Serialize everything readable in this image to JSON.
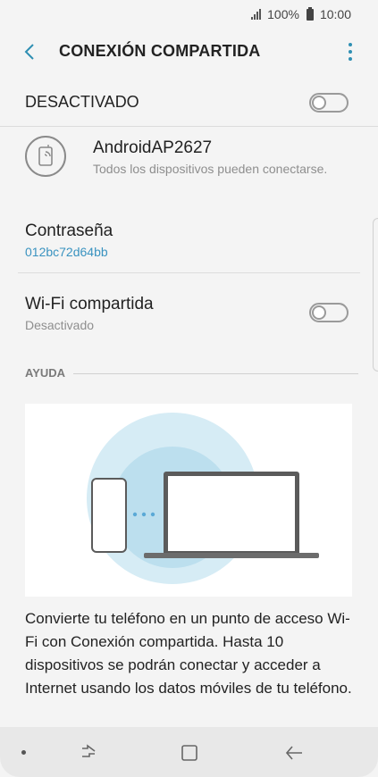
{
  "status_bar": {
    "signal_icon": "signal-icon",
    "battery_percent": "100%",
    "battery_icon": "battery-icon",
    "time": "10:00"
  },
  "header": {
    "title": "CONEXIÓN COMPARTIDA",
    "back_icon": "back-arrow-icon",
    "menu_icon": "more-options-icon"
  },
  "master_switch": {
    "label": "DESACTIVADO",
    "state": "off"
  },
  "network": {
    "icon": "hotspot-device-icon",
    "name": "AndroidAP2627",
    "subtitle": "Todos los dispositivos pueden conectarse."
  },
  "password": {
    "label": "Contraseña",
    "value": "012bc72d64bb"
  },
  "wifi_sharing": {
    "label": "Wi-Fi compartida",
    "status": "Desactivado",
    "state": "off"
  },
  "help": {
    "heading": "AYUDA",
    "illustration": "phone-laptop-hotspot-illustration",
    "text": "Convierte tu teléfono en un punto de acceso Wi-Fi con Conexión compartida. Hasta 10 dispositivos se podrán conectar y acceder a Internet usando los datos móviles de tu teléfono."
  },
  "nav_bar": {
    "dot_icon": "nav-dot-icon",
    "recents_icon": "recents-icon",
    "home_icon": "home-icon",
    "back_icon": "back-icon"
  },
  "colors": {
    "accent": "#3a93c0",
    "background": "#f4f4f4",
    "illustration_circle": "#d6ecf5"
  }
}
